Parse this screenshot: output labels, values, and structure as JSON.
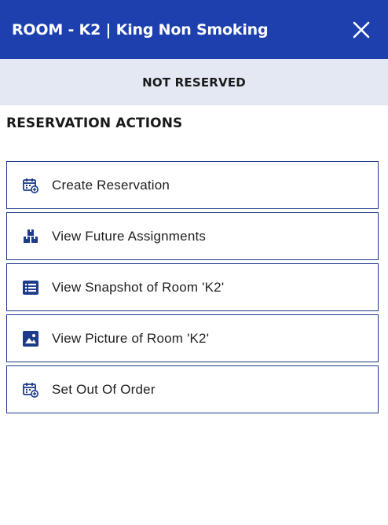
{
  "header": {
    "title": "ROOM - K2 | King Non Smoking",
    "close_icon": "close-icon"
  },
  "status": {
    "text": "NOT RESERVED"
  },
  "section": {
    "title": "RESERVATION ACTIONS"
  },
  "actions": [
    {
      "label": "Create Reservation",
      "icon": "calendar-add-icon"
    },
    {
      "label": "View Future Assignments",
      "icon": "boxes-icon"
    },
    {
      "label": "View Snapshot of Room 'K2'",
      "icon": "list-icon"
    },
    {
      "label": "View Picture of Room 'K2'",
      "icon": "image-icon"
    },
    {
      "label": "Set Out Of Order",
      "icon": "calendar-add-icon"
    }
  ],
  "colors": {
    "header_bg": "#1e40af",
    "status_bg": "#e3e8f3",
    "accent": "#1e3a8a"
  }
}
